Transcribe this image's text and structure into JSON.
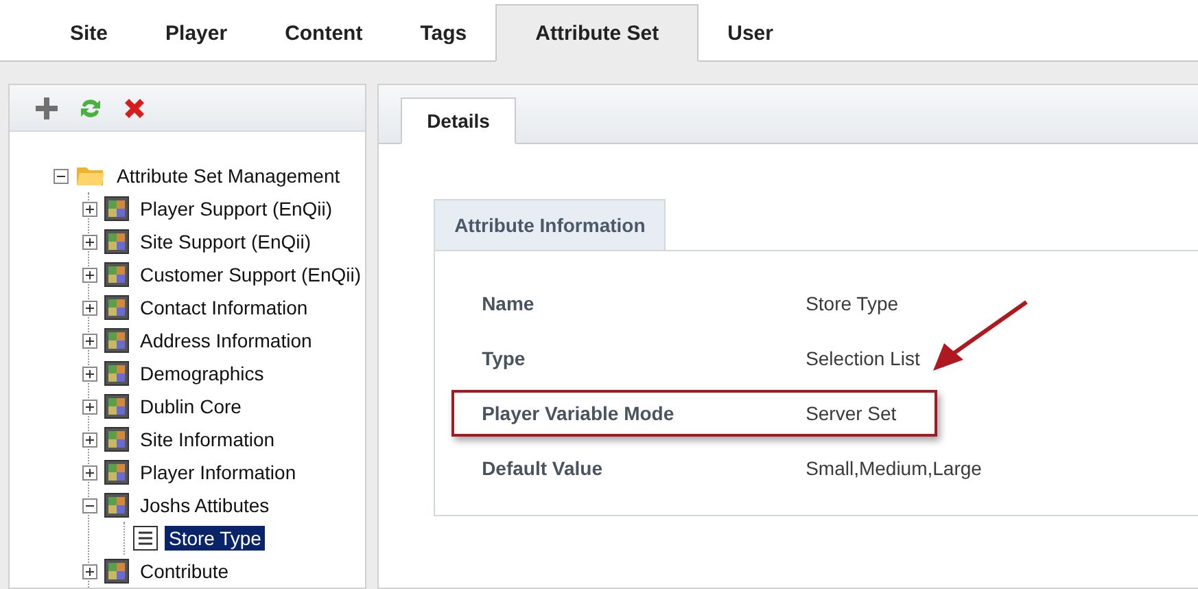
{
  "tabs": [
    {
      "label": "Site",
      "selected": false
    },
    {
      "label": "Player",
      "selected": false
    },
    {
      "label": "Content",
      "selected": false
    },
    {
      "label": "Tags",
      "selected": false
    },
    {
      "label": "Attribute Set",
      "selected": true
    },
    {
      "label": "User",
      "selected": false
    }
  ],
  "toolbar": [
    {
      "kind": "add"
    },
    {
      "kind": "refresh"
    },
    {
      "kind": "delete"
    }
  ],
  "tree": {
    "label": "Attribute Set Management",
    "expanded": true,
    "children": [
      {
        "label": "Player Support (EnQii)",
        "expanded": false,
        "selected": false
      },
      {
        "label": "Site Support (EnQii)",
        "expanded": false,
        "selected": false
      },
      {
        "label": "Customer Support (EnQii)",
        "expanded": false,
        "selected": false
      },
      {
        "label": "Contact Information",
        "expanded": false,
        "selected": false
      },
      {
        "label": "Address Information",
        "expanded": false,
        "selected": false
      },
      {
        "label": "Demographics",
        "expanded": false,
        "selected": false
      },
      {
        "label": "Dublin Core",
        "expanded": false,
        "selected": false
      },
      {
        "label": "Site Information",
        "expanded": false,
        "selected": false
      },
      {
        "label": "Player Information",
        "expanded": false,
        "selected": false
      },
      {
        "label": "Joshs Attibutes",
        "expanded": true,
        "selected": false,
        "children": [
          {
            "label": "Store Type",
            "selected": true
          }
        ]
      },
      {
        "label": "Contribute",
        "expanded": false,
        "selected": false
      }
    ]
  },
  "detail_tabs": [
    {
      "label": "Details",
      "selected": true
    }
  ],
  "section": {
    "title": "Attribute Information",
    "rows": [
      {
        "label": "Name",
        "value": "Store Type",
        "highlighted": false
      },
      {
        "label": "Type",
        "value": "Selection List",
        "highlighted": false
      },
      {
        "label": "Player Variable Mode",
        "value": "Server Set",
        "highlighted": true
      },
      {
        "label": "Default Value",
        "value": "Small,Medium,Large",
        "highlighted": false
      }
    ]
  }
}
